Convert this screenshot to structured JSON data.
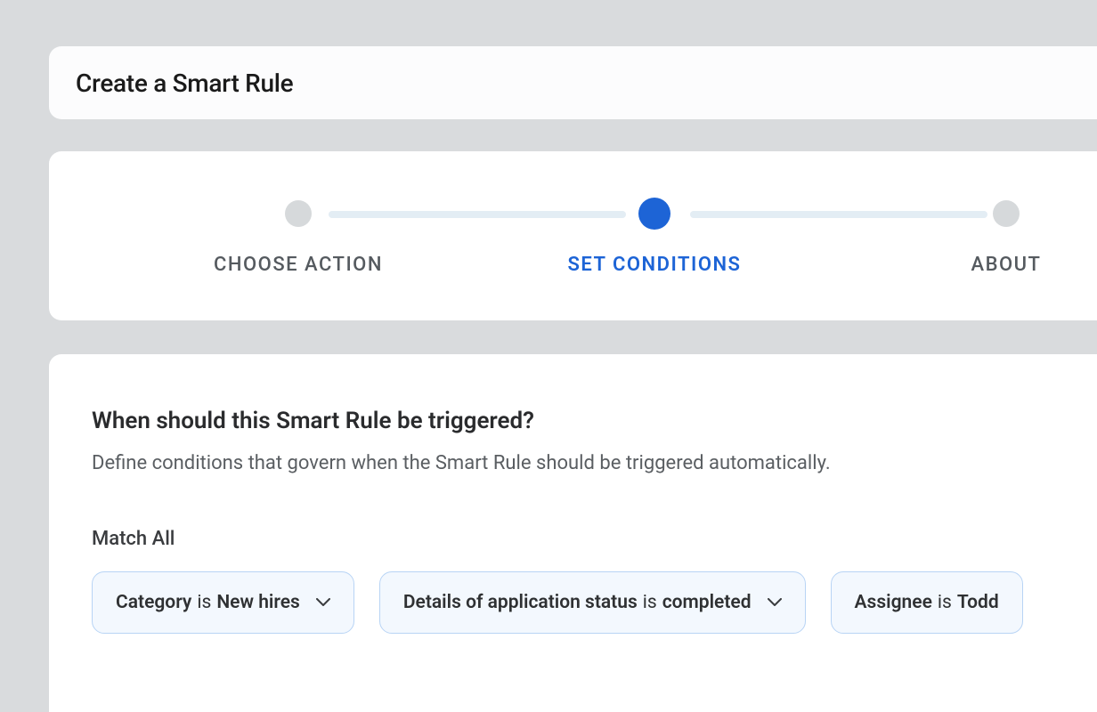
{
  "header": {
    "title": "Create a Smart Rule"
  },
  "stepper": {
    "steps": [
      {
        "label": "CHOOSE ACTION",
        "active": false
      },
      {
        "label": "SET CONDITIONS",
        "active": true
      },
      {
        "label": "ABOUT",
        "active": false
      }
    ]
  },
  "conditions": {
    "heading": "When should this Smart Rule be triggered?",
    "description": "Define conditions that govern when the Smart Rule should be triggered automatically.",
    "match_mode_label": "Match All",
    "rules": [
      {
        "field": "Category",
        "operator": "is",
        "value": "New hires"
      },
      {
        "field": "Details of application status",
        "operator": "is",
        "value": "completed"
      },
      {
        "field": "Assignee",
        "operator": "is",
        "value": "Todd"
      }
    ]
  }
}
